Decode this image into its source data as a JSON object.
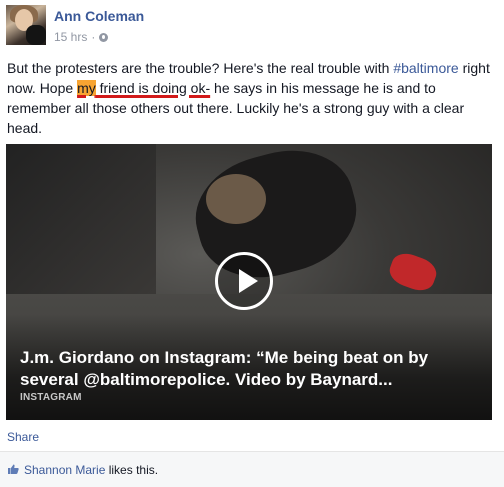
{
  "post": {
    "author": "Ann Coleman",
    "time": "15 hrs",
    "separator": "·",
    "text": {
      "part1": "But the protesters are the trouble? Here's the real trouble with ",
      "hashtag": "#baltimore",
      "part2": " right now. Hope ",
      "highlight_pre": "my",
      "highlight_rest": " friend is doing ok-",
      "part3": " he says in his message he is and to remember all those others out there. Luckily he's a strong guy with a clear head."
    },
    "link": {
      "title": "J.m. Giordano on Instagram: “Me being beat on by several @baltimorepolice. Video by Baynard...",
      "source": "INSTAGRAM"
    },
    "actions": {
      "share_label": "Share"
    },
    "likes": {
      "name": "Shannon Marie",
      "suffix": " likes this."
    }
  },
  "colors": {
    "link_blue": "#3b5998",
    "highlight_orange": "#f7a432",
    "underline_red": "#d21a1a",
    "meta_gray": "#9197a3"
  },
  "icons": [
    "globe-icon",
    "play-icon",
    "thumbs-up-icon"
  ]
}
